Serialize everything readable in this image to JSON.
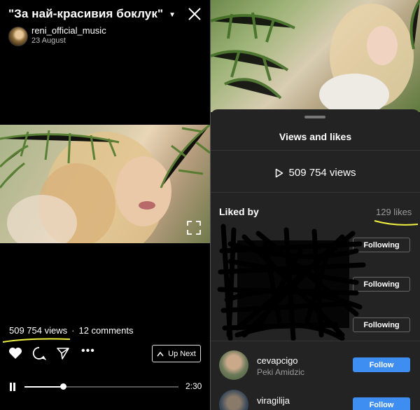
{
  "left": {
    "title": "\"За най-красивия боклук\"",
    "username": "reni_official_music",
    "date": "23 August",
    "views": "509 754 views",
    "separator": "·",
    "comments": "12 comments",
    "up_next_label": "Up Next",
    "duration": "2:30",
    "playback_progress": 0.25
  },
  "right": {
    "sheet_title": "Views and likes",
    "views": "509 754 views",
    "liked_by_label": "Liked by",
    "likes_count": "129 likes",
    "redacted_rows": [
      {
        "button": "Following"
      },
      {
        "button": "Following"
      },
      {
        "button": "Following"
      }
    ],
    "users": [
      {
        "username": "cevapcigo",
        "full_name": "Peki Amidzic",
        "button": "Follow"
      },
      {
        "username": "viragilija",
        "full_name": "",
        "button": "Follow"
      }
    ]
  },
  "colors": {
    "follow_blue": "#3d8ef0",
    "highlight_yellow": "#f0f040",
    "sheet_bg": "#232323"
  }
}
